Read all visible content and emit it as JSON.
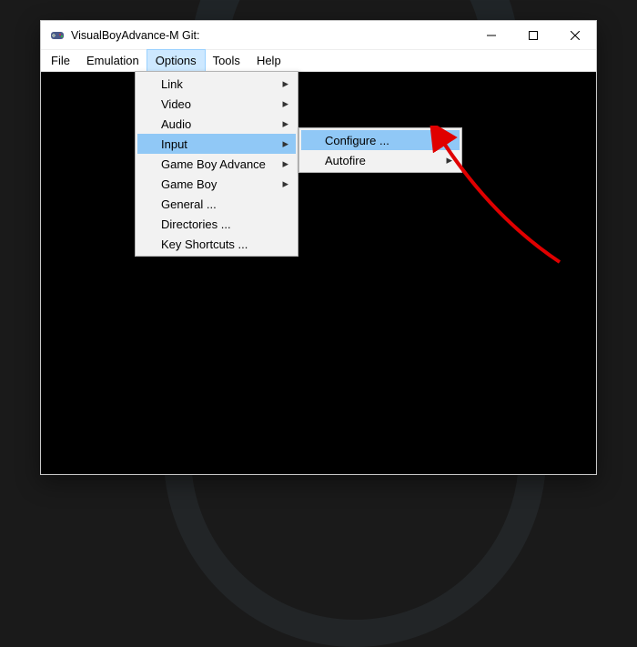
{
  "window": {
    "title": "VisualBoyAdvance-M Git:"
  },
  "menubar": {
    "items": [
      {
        "label": "File",
        "open": false
      },
      {
        "label": "Emulation",
        "open": false
      },
      {
        "label": "Options",
        "open": true
      },
      {
        "label": "Tools",
        "open": false
      },
      {
        "label": "Help",
        "open": false
      }
    ]
  },
  "optionsMenu": {
    "items": [
      {
        "label": "Link",
        "submenu": true,
        "highlight": false
      },
      {
        "label": "Video",
        "submenu": true,
        "highlight": false
      },
      {
        "label": "Audio",
        "submenu": true,
        "highlight": false
      },
      {
        "label": "Input",
        "submenu": true,
        "highlight": true
      },
      {
        "label": "Game Boy Advance",
        "submenu": true,
        "highlight": false
      },
      {
        "label": "Game Boy",
        "submenu": true,
        "highlight": false
      },
      {
        "label": "General ...",
        "submenu": false,
        "highlight": false
      },
      {
        "label": "Directories ...",
        "submenu": false,
        "highlight": false
      },
      {
        "label": "Key Shortcuts ...",
        "submenu": false,
        "highlight": false
      }
    ]
  },
  "inputSubmenu": {
    "items": [
      {
        "label": "Configure ...",
        "submenu": false,
        "highlight": true
      },
      {
        "label": "Autofire",
        "submenu": true,
        "highlight": false
      }
    ]
  },
  "annotation": {
    "arrow_color": "#e00000"
  }
}
